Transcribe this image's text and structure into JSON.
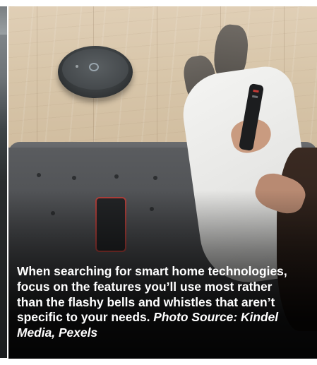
{
  "slide": {
    "caption_text": "When searching for smart home technologies, focus on the features you’ll use most rather than the flashy bells and whistles that aren’t specific to your needs.",
    "photo_source": "Photo Source: Kindel Media, Pexels"
  },
  "icons": [
    "robot-vacuum-image",
    "tv-remote-image",
    "smartphone-image"
  ]
}
